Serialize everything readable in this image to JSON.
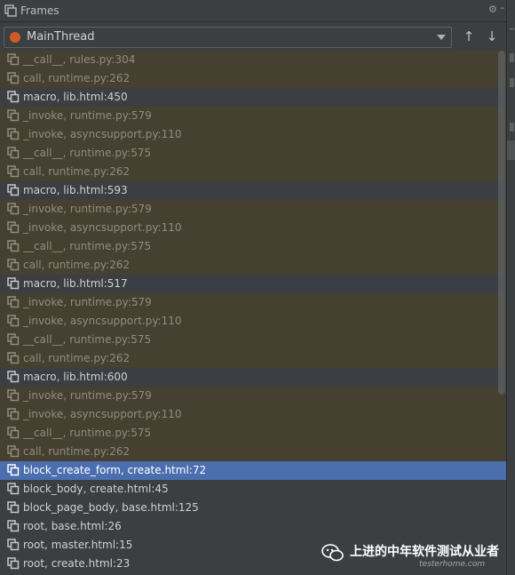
{
  "header": {
    "title": "Frames"
  },
  "thread_selector": {
    "value": "MainThread"
  },
  "frames": [
    {
      "label": "__call__, rules.py:304",
      "kind": "lib"
    },
    {
      "label": "call, runtime.py:262",
      "kind": "lib"
    },
    {
      "label": "macro, lib.html:450",
      "kind": "user"
    },
    {
      "label": "_invoke, runtime.py:579",
      "kind": "lib"
    },
    {
      "label": "_invoke, asyncsupport.py:110",
      "kind": "lib"
    },
    {
      "label": "__call__, runtime.py:575",
      "kind": "lib"
    },
    {
      "label": "call, runtime.py:262",
      "kind": "lib"
    },
    {
      "label": "macro, lib.html:593",
      "kind": "user"
    },
    {
      "label": "_invoke, runtime.py:579",
      "kind": "lib"
    },
    {
      "label": "_invoke, asyncsupport.py:110",
      "kind": "lib"
    },
    {
      "label": "__call__, runtime.py:575",
      "kind": "lib"
    },
    {
      "label": "call, runtime.py:262",
      "kind": "lib"
    },
    {
      "label": "macro, lib.html:517",
      "kind": "user"
    },
    {
      "label": "_invoke, runtime.py:579",
      "kind": "lib"
    },
    {
      "label": "_invoke, asyncsupport.py:110",
      "kind": "lib"
    },
    {
      "label": "__call__, runtime.py:575",
      "kind": "lib"
    },
    {
      "label": "call, runtime.py:262",
      "kind": "lib"
    },
    {
      "label": "macro, lib.html:600",
      "kind": "user"
    },
    {
      "label": "_invoke, runtime.py:579",
      "kind": "lib"
    },
    {
      "label": "_invoke, asyncsupport.py:110",
      "kind": "lib"
    },
    {
      "label": "__call__, runtime.py:575",
      "kind": "lib"
    },
    {
      "label": "call, runtime.py:262",
      "kind": "lib"
    },
    {
      "label": "block_create_form, create.html:72",
      "kind": "selected"
    },
    {
      "label": "block_body, create.html:45",
      "kind": "plain"
    },
    {
      "label": "block_page_body, base.html:125",
      "kind": "plain"
    },
    {
      "label": "root, base.html:26",
      "kind": "plain"
    },
    {
      "label": "root, master.html:15",
      "kind": "plain"
    },
    {
      "label": "root, create.html:23",
      "kind": "plain"
    }
  ],
  "watermark": {
    "text": "上进的中年软件测试从业者",
    "sub": "testerhome.com"
  },
  "colors": {
    "library_frame_bg": "#45402f",
    "selected_frame_bg": "#4b6eaf",
    "thread_dot": "#cf5b28"
  }
}
